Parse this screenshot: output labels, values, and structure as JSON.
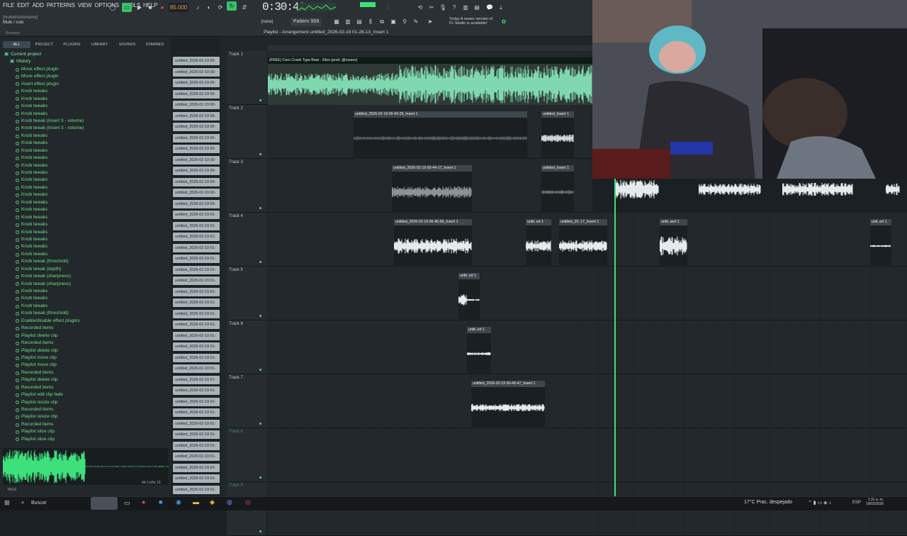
{
  "menu": [
    "FILE",
    "EDIT",
    "ADD",
    "PATTERNS",
    "VIEW",
    "OPTIONS",
    "TOOLS",
    "HELP"
  ],
  "hint": [
    "[muted/solo/name]",
    "Mute / solo"
  ],
  "tempo": "85.000",
  "time": "0:30:42",
  "pattern": "Pattern 999",
  "snap": "(none)",
  "update_notice": [
    "Today  A newer version of",
    "FL Studio is available!"
  ],
  "playlist_title": "Playlist - Arrangement  untitled_2026-02-19 01-28-13_Insert 1",
  "browser_tabs": [
    "ALL",
    "PROJECT",
    "PLUGINS",
    "LIBRARY",
    "SOUNDS",
    "STARRED"
  ],
  "browser_root": "Browser",
  "tree": {
    "root": "Current project",
    "history": "History",
    "items": [
      "Move effect plugin",
      "Move effect plugin",
      "Insert effect plugin",
      "Knob tweaks",
      "Knob tweaks",
      "Knob tweaks",
      "Knob tweaks",
      "Knob tweak (Insert 3 - volume)",
      "Knob tweak (Insert 3 - volume)",
      "Knob tweaks",
      "Knob tweaks",
      "Knob tweaks",
      "Knob tweaks",
      "Knob tweaks",
      "Knob tweaks",
      "Knob tweaks",
      "Knob tweaks",
      "Knob tweaks",
      "Knob tweaks",
      "Knob tweaks",
      "Knob tweaks",
      "Knob tweaks",
      "Knob tweaks",
      "Knob tweaks",
      "Knob tweaks",
      "Knob tweaks",
      "Knob tweak (threshold)",
      "Knob tweak (depth)",
      "Knob tweak (sharpness)",
      "Knob tweak (sharpness)",
      "Knob tweaks",
      "Knob tweaks",
      "Knob tweaks",
      "Knob tweak (threshold)",
      "Enable/disable effect plugins",
      "Recorded items",
      "Playlist delete clip",
      "Recorded items",
      "Playlist delete clip",
      "Playlist move clip",
      "Playlist move clip",
      "Recorded items",
      "Playlist delete clip",
      "Recorded items",
      "Playlist edit clip fade",
      "Playlist resize clip",
      "Recorded items",
      "Playlist resize clip",
      "Recorded items",
      "Playlist slice clip",
      "Playlist slice clip"
    ]
  },
  "sample_rate": "44.1 kHz 16",
  "tags_label": "TAGS",
  "browser_files": [
    "untitled_2026-02-19 00-",
    "untitled_2026-02-19 00-",
    "untitled_2026-02-19 00-",
    "untitled_2026-02-19 00-",
    "untitled_2026-02-19 00-",
    "untitled_2026-02-19 00-",
    "untitled_2026-02-19 00-",
    "untitled_2026-02-19 00-",
    "untitled_2026-02-19 00-",
    "untitled_2026-02-19 00-",
    "untitled_2026-02-19 00-",
    "untitled_2026-02-19 00-",
    "untitled_2026-02-19 00-",
    "untitled_2026-02-19 00-",
    "untitled_2026-02-19 01-",
    "untitled_2026-02-19 01-",
    "untitled_2026-02-19 01-",
    "untitled_2026-02-19 01-",
    "untitled_2026-02-19 01-",
    "untitled_2026-02-19 01-",
    "untitled_2026-02-19 01-",
    "untitled_2026-02-19 01-",
    "untitled_2026-02-19 01-",
    "untitled_2026-02-19 01-",
    "untitled_2026-02-19 01-",
    "untitled_2026-02-19 01-",
    "untitled_2026-02-19 01-",
    "untitled_2026-02-19 01-",
    "untitled_2026-02-19 01-",
    "untitled_2026-02-19 01-",
    "untitled_2026-02-19 01-",
    "untitled_2026-02-19 01-",
    "untitled_2026-02-19 01-",
    "untitled_2026-02-19 01-",
    "untitled_2026-02-19 01-",
    "untitled_2026-02-19 01-",
    "untitled_2026-02-19 01-",
    "untitled_2026-02-19 01-",
    "untitled_2026-02-19 01-",
    "untitled_2026-02-19 01-"
  ],
  "tracks": [
    "Track 1",
    "Track 2",
    "Track 3",
    "Track 4",
    "Track 5",
    "Track 6",
    "Track 7",
    "Track 8",
    "Track 9"
  ],
  "clips": {
    "c1": "(FREE) Cero  Crank Type Beat - 2dos (prod. @russov)",
    "c2a": "untitled_2026-02-19 00-43-28_Insert 1",
    "c2b": "untitled_Insert 1",
    "c3a": "untitled_2026-02-19 00-44-17_Insert 1",
    "c3b": "untitled_Insert 1",
    "c4a": "untitled_2026-02-19 00-45-56_Insert 1",
    "c4b": "untit..ert 1",
    "c4c": "untitled_20..17_Insert 1",
    "c4d": "untit..sert 1",
    "c4e": "unti..ert 1",
    "c5": "untit..ert 1",
    "c6": "untit..ert 1",
    "c7": "untitled_2026-02-19 00-49-47_Insert 1"
  },
  "taskbar": {
    "search": "Buscar",
    "weather": "17°C  Prac. despejado",
    "lang": "ESP",
    "time": "1:31 a. m.",
    "date": "19/02/2026"
  },
  "colors": {
    "accent": "#3ee07c",
    "wave": "#7fd8b0",
    "menu_bg": "#2a3034"
  }
}
